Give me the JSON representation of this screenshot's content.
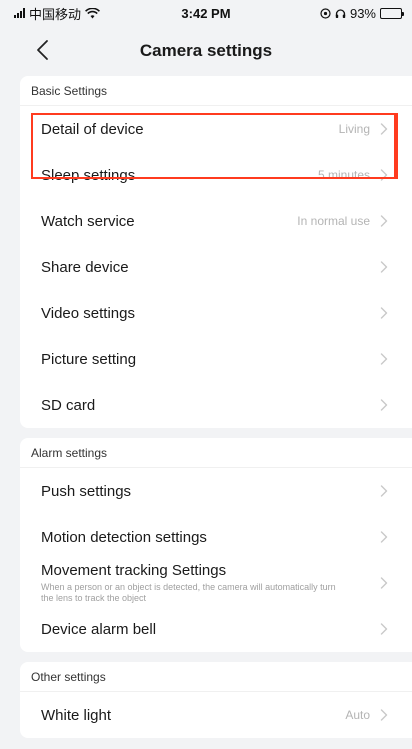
{
  "status_bar": {
    "carrier": "中国移动",
    "time": "3:42 PM",
    "battery": "93%",
    "battery_level": 0.93
  },
  "nav": {
    "title": "Camera settings",
    "back_icon": "chevron-left-icon"
  },
  "sections": [
    {
      "title": "Basic Settings",
      "rows": [
        {
          "label": "Detail of device",
          "value": "Living"
        },
        {
          "label": "Sleep settings",
          "value": "5 minutes"
        },
        {
          "label": "Watch service",
          "value": "In normal use"
        },
        {
          "label": "Share device",
          "value": ""
        },
        {
          "label": "Video settings",
          "value": ""
        },
        {
          "label": "Picture setting",
          "value": ""
        },
        {
          "label": "SD card",
          "value": ""
        }
      ]
    },
    {
      "title": "Alarm settings",
      "rows": [
        {
          "label": "Push settings",
          "value": ""
        },
        {
          "label": "Motion detection settings",
          "value": ""
        },
        {
          "label": "Movement tracking Settings",
          "sub": "When a person or an object is detected, the camera will automatically turn the lens to track the object",
          "value": ""
        },
        {
          "label": "Device alarm bell",
          "value": ""
        }
      ]
    },
    {
      "title": "Other settings",
      "rows": [
        {
          "label": "White light",
          "value": "Auto"
        }
      ]
    }
  ],
  "colors": {
    "background": "#f2f3f5",
    "highlight": "#ff3b1f",
    "value_text": "#b4b4b4"
  }
}
